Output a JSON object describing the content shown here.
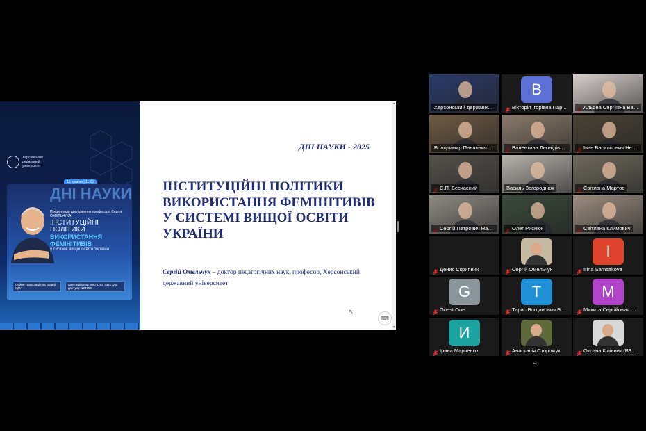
{
  "poster": {
    "university": "Херсонський\nдержавний\nуніверситет",
    "date_badge": "15 травня | 11:00",
    "big_word": "ДНІ НАУКИ",
    "presentation_line": "Презентація дослідження професора Сергія ОМЕЛЬЧУКА",
    "title_line1": "ІНСТИТУЦІЙНІ ПОЛІТИКИ",
    "title_line2": "ВИКОРИСТАННЯ ФЕМІНІТИВІВ",
    "title_line3": "у системі вищої освіти України",
    "chip_left": "Online-трансляція на каналі ХДУ",
    "chip_right": "Ідентифікатор: 880 4162 7361 Код доступу: 123799"
  },
  "slide": {
    "days": "ДНІ НАУКИ - 2025",
    "title": "ІНСТИТУЦІЙНІ ПОЛІТИКИ ВИКОРИСТАННЯ ФЕМІНІТИВІВ У СИСТЕМІ ВИЩОЇ ОСВІТИ УКРАЇНИ",
    "author_name": "Сергій Омельчук",
    "author_desc": " – доктор педагогічних наук, професор, Херсонський державний університет"
  },
  "participants": [
    {
      "name": "Херсонський державний ...",
      "type": "video",
      "bg": "#2a3b6a",
      "muted": false
    },
    {
      "name": "Вікторія Ігорівна Пар...",
      "type": "letter",
      "letter": "В",
      "color": "#5b6fd6",
      "muted": true
    },
    {
      "name": "Альона Сергіївна Вал...",
      "type": "video",
      "bg": "#d7cfcc",
      "muted": true
    },
    {
      "name": "Володимир Павлович Ол...",
      "type": "video",
      "bg": "#6e5a43",
      "muted": false
    },
    {
      "name": "Валентина Леонідівна...",
      "type": "video",
      "bg": "#8a7b6c",
      "muted": true
    },
    {
      "name": "Іван Васильович Нем...",
      "type": "video",
      "bg": "#4a4336",
      "muted": true
    },
    {
      "name": "С.П. Бесчасний",
      "type": "video",
      "bg": "#55524c",
      "muted": true
    },
    {
      "name": "Василь Загороднюк",
      "type": "video",
      "bg": "#b7b3ad",
      "muted": false,
      "active": true
    },
    {
      "name": "Світлана   Мартос",
      "type": "video",
      "bg": "#6f6a5c",
      "muted": true
    },
    {
      "name": "Сергій Петрович Наза...",
      "type": "video",
      "bg": "#8f8a84",
      "muted": true
    },
    {
      "name": "Олег Риснюк",
      "type": "video",
      "bg": "#3a4a3a",
      "muted": true
    },
    {
      "name": "Світлана Климович",
      "type": "video",
      "bg": "#9c8d80",
      "muted": true
    },
    {
      "name": "Денис Скрипник",
      "type": "none",
      "muted": true
    },
    {
      "name": "Сергій Омельчук",
      "type": "photo",
      "bg": "#c6b9a2",
      "muted": true
    },
    {
      "name": "Irina Samsakova",
      "type": "letter",
      "letter": "I",
      "color": "#e0442c",
      "muted": true
    },
    {
      "name": "Guest One",
      "type": "letter",
      "letter": "G",
      "color": "#8a959c",
      "muted": true
    },
    {
      "name": "Тарас Богданович Бог...",
      "type": "letter",
      "letter": "T",
      "color": "#1f8fd6",
      "muted": true
    },
    {
      "name": "Микита Сергійович Ш...",
      "type": "letter",
      "letter": "M",
      "color": "#b043c9",
      "muted": true
    },
    {
      "name": "Ірина Марченко",
      "type": "letter",
      "letter": "И",
      "color": "#1ba3a0",
      "muted": true
    },
    {
      "name": "Анастасія Сторожук",
      "type": "photo",
      "bg": "#5f6a3c",
      "muted": true
    },
    {
      "name": "Оксана Кілівник (ВЗЯ...",
      "type": "photo",
      "bg": "#d8d8d8",
      "muted": true
    }
  ],
  "icons": {
    "mic": "mic-muted-icon",
    "more": "chevron-down-icon",
    "keyboard": "keyboard-icon"
  }
}
